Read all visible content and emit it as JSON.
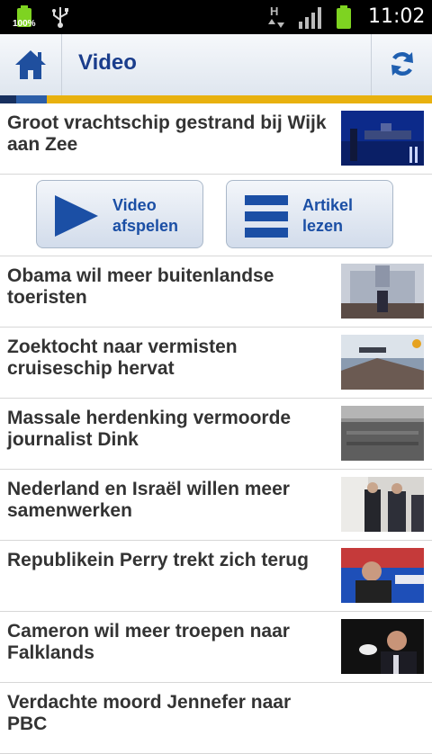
{
  "status": {
    "battery_small_pct": "100%",
    "clock": "11:02",
    "network": "H"
  },
  "header": {
    "title": "Video"
  },
  "featured": {
    "title": "Groot vrachtschip gestrand bij Wijk aan Zee",
    "play_label_line1": "Video",
    "play_label_line2": "afspelen",
    "article_label_line1": "Artikel",
    "article_label_line2": "lezen"
  },
  "items": [
    {
      "title": "Obama wil meer buitenlandse toeristen"
    },
    {
      "title": "Zoektocht naar vermisten cruiseschip hervat"
    },
    {
      "title": "Massale herdenking vermoorde journalist Dink"
    },
    {
      "title": "Nederland en Israël willen meer samenwerken"
    },
    {
      "title": "Republikein Perry trekt zich terug"
    },
    {
      "title": "Cameron wil meer troepen naar Falklands"
    },
    {
      "title": "Verdachte moord Jennefer naar PBC"
    }
  ],
  "colors": {
    "accent": "#1a3d8c",
    "stripe": "#e8b10f",
    "button_text": "#1b4fa5"
  },
  "icons": [
    "home-icon",
    "refresh-icon",
    "play-icon",
    "list-icon",
    "usb-icon",
    "signal-icon",
    "battery-icon"
  ]
}
